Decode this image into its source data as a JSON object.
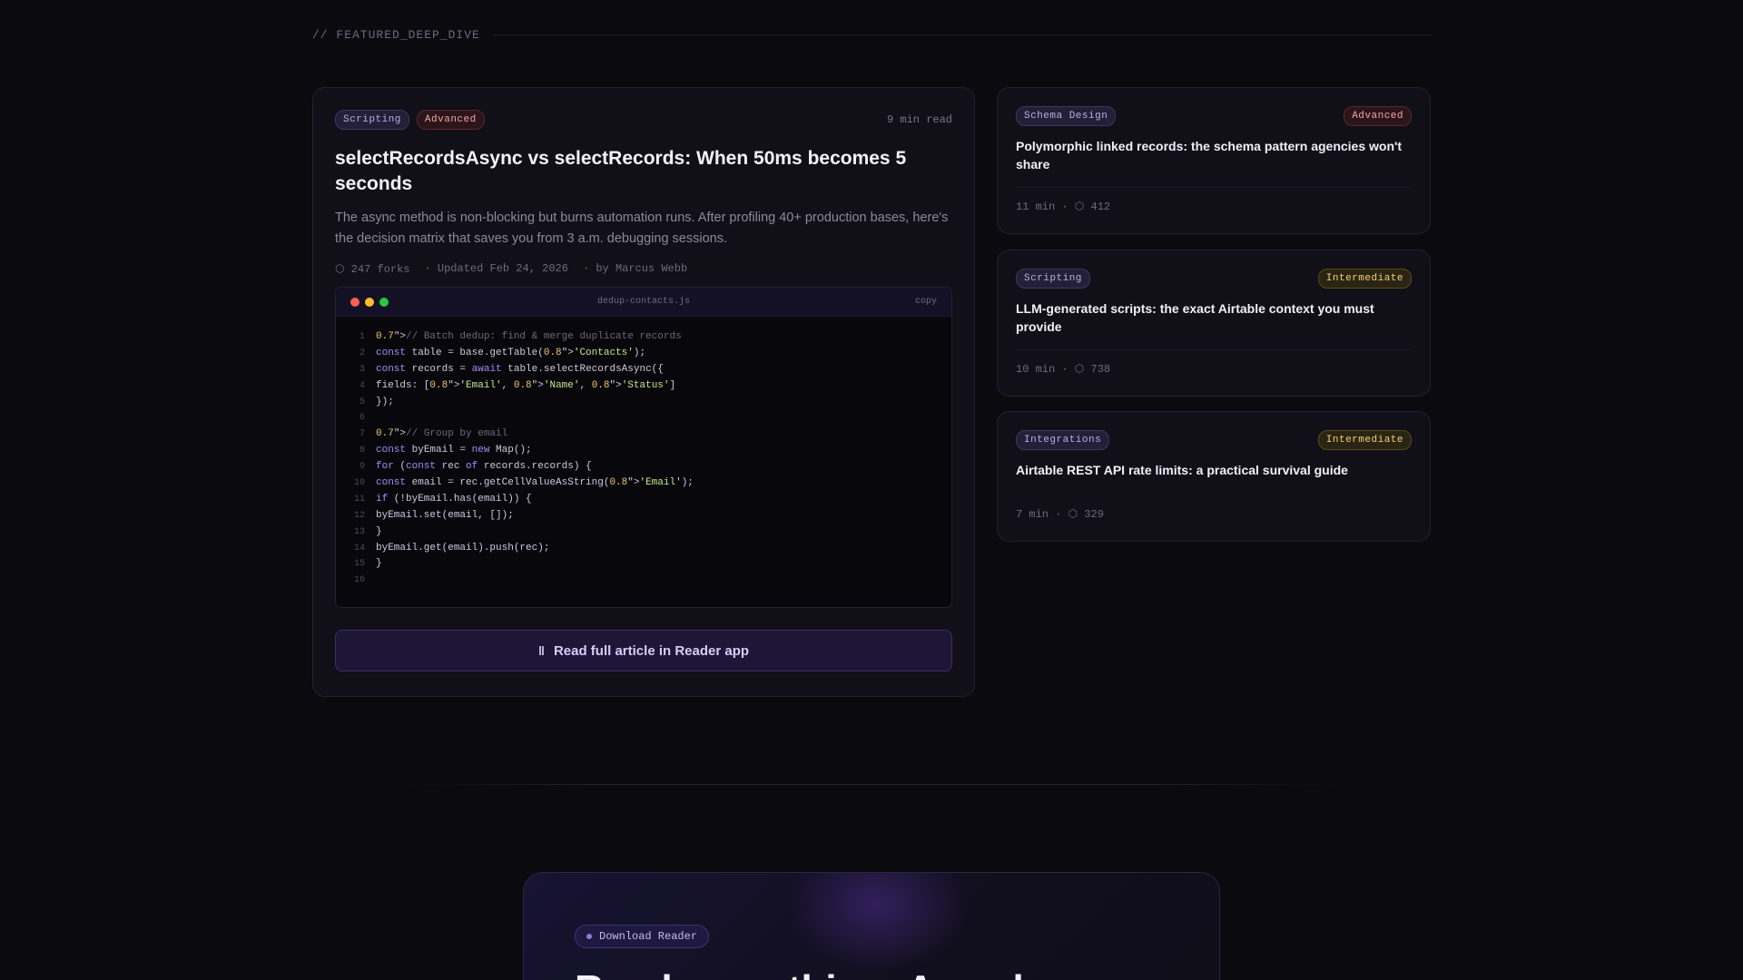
{
  "section": {
    "label": "// FEATURED_DEEP_DIVE"
  },
  "featured": {
    "tags": [
      "Scripting",
      "Advanced"
    ],
    "read_time": "9 min read",
    "title": "selectRecordsAsync vs selectRecords: When 50ms becomes 5 seconds",
    "description": "The async method is non-blocking but burns automation runs. After profiling 40+ production bases, here's the decision matrix that saves you from 3 a.m. debugging sessions.",
    "meta": {
      "forks": "⬡ 247 forks",
      "updated": "· Updated Feb 24, 2026",
      "author": "· by Marcus Webb"
    },
    "code": {
      "filename": "dedup-contacts.js",
      "copy_label": "copy",
      "lines": [
        "0.7\">// Batch dedup: find & merge duplicate records",
        "const table = base.getTable(0.8\">'Contacts');",
        "const records = await table.selectRecordsAsync({",
        "fields: [0.8\">'Email', 0.8\">'Name', 0.8\">'Status']",
        "});",
        "",
        "0.7\">// Group by email",
        "const byEmail = new Map();",
        "for (const rec of records.records) {",
        "const email = rec.getCellValueAsString(0.8\">'Email');",
        "if (!byEmail.has(email)) {",
        "byEmail.set(email, []);",
        "}",
        "byEmail.get(email).push(rec);",
        "}",
        ""
      ]
    },
    "cta_label": "Read full article in Reader app",
    "cta_icon": "book-icon"
  },
  "side_cards": [
    {
      "category": "Schema Design",
      "level": "Advanced",
      "title": "Polymorphic linked records: the schema pattern agencies won't share",
      "stats": "11 min · ⬡ 412"
    },
    {
      "category": "Scripting",
      "level": "Intermediate",
      "title": "LLM-generated scripts: the exact Airtable context you must provide",
      "stats": "10 min · ⬡ 738"
    },
    {
      "category": "Integrations",
      "level": "Intermediate",
      "title": "Airtable REST API rate limits: a practical survival guide",
      "stats": "7 min · ⬡ 329"
    }
  ],
  "promo": {
    "pill": "Download Reader",
    "headline": "Read everything. Anywh"
  },
  "colors": {
    "accent": "#8f7be0",
    "background": "#0b0a0f",
    "advanced": "#f0a6a6",
    "intermediate": "#f2d27a"
  }
}
